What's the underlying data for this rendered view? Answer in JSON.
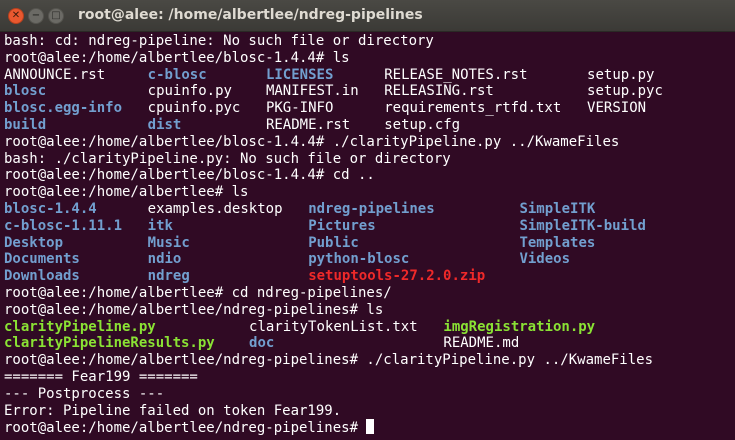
{
  "window": {
    "title": "root@alee: /home/albertlee/ndreg-pipelines",
    "close_glyph": "✕",
    "min_glyph": "−",
    "max_glyph": "□"
  },
  "colors": {
    "background": "#300a24",
    "text": "#ffffff",
    "directory": "#729fcf",
    "executable": "#8ae234",
    "archive": "#ef2929"
  },
  "lines": [
    {
      "text": "bash: cd: ndreg-pipeline: No such file or directory"
    },
    {
      "text": "root@alee:/home/albertlee/blosc-1.4.4# ls"
    },
    {
      "cells": [
        {
          "col": 0,
          "text": "ANNOUNCE.rst",
          "kind": "txt"
        },
        {
          "col": 17,
          "text": "c-blosc",
          "kind": "dir"
        },
        {
          "col": 31,
          "text": "LICENSES",
          "kind": "dir"
        },
        {
          "col": 45,
          "text": "RELEASE_NOTES.rst",
          "kind": "txt"
        },
        {
          "col": 69,
          "text": "setup.py",
          "kind": "txt"
        }
      ]
    },
    {
      "cells": [
        {
          "col": 0,
          "text": "blosc",
          "kind": "dir"
        },
        {
          "col": 17,
          "text": "cpuinfo.py",
          "kind": "txt"
        },
        {
          "col": 31,
          "text": "MANIFEST.in",
          "kind": "txt"
        },
        {
          "col": 45,
          "text": "RELEASING.rst",
          "kind": "txt"
        },
        {
          "col": 69,
          "text": "setup.pyc",
          "kind": "txt"
        }
      ]
    },
    {
      "cells": [
        {
          "col": 0,
          "text": "blosc.egg-info",
          "kind": "dir"
        },
        {
          "col": 17,
          "text": "cpuinfo.pyc",
          "kind": "txt"
        },
        {
          "col": 31,
          "text": "PKG-INFO",
          "kind": "txt"
        },
        {
          "col": 45,
          "text": "requirements_rtfd.txt",
          "kind": "txt"
        },
        {
          "col": 69,
          "text": "VERSION",
          "kind": "txt"
        }
      ]
    },
    {
      "cells": [
        {
          "col": 0,
          "text": "build",
          "kind": "dir"
        },
        {
          "col": 17,
          "text": "dist",
          "kind": "dir"
        },
        {
          "col": 31,
          "text": "README.rst",
          "kind": "txt"
        },
        {
          "col": 45,
          "text": "setup.cfg",
          "kind": "txt"
        }
      ]
    },
    {
      "text": "root@alee:/home/albertlee/blosc-1.4.4# ./clarityPipeline.py ../KwameFiles"
    },
    {
      "text": "bash: ./clarityPipeline.py: No such file or directory"
    },
    {
      "text": "root@alee:/home/albertlee/blosc-1.4.4# cd .."
    },
    {
      "text": "root@alee:/home/albertlee# ls"
    },
    {
      "cells": [
        {
          "col": 0,
          "text": "blosc-1.4.4",
          "kind": "dir"
        },
        {
          "col": 17,
          "text": "examples.desktop",
          "kind": "txt"
        },
        {
          "col": 36,
          "text": "ndreg-pipelines",
          "kind": "dir"
        },
        {
          "col": 61,
          "text": "SimpleITK",
          "kind": "dir"
        }
      ]
    },
    {
      "cells": [
        {
          "col": 0,
          "text": "c-blosc-1.11.1",
          "kind": "dir"
        },
        {
          "col": 17,
          "text": "itk",
          "kind": "dir"
        },
        {
          "col": 36,
          "text": "Pictures",
          "kind": "dir"
        },
        {
          "col": 61,
          "text": "SimpleITK-build",
          "kind": "dir"
        }
      ]
    },
    {
      "cells": [
        {
          "col": 0,
          "text": "Desktop",
          "kind": "dir"
        },
        {
          "col": 17,
          "text": "Music",
          "kind": "dir"
        },
        {
          "col": 36,
          "text": "Public",
          "kind": "dir"
        },
        {
          "col": 61,
          "text": "Templates",
          "kind": "dir"
        }
      ]
    },
    {
      "cells": [
        {
          "col": 0,
          "text": "Documents",
          "kind": "dir"
        },
        {
          "col": 17,
          "text": "ndio",
          "kind": "dir"
        },
        {
          "col": 36,
          "text": "python-blosc",
          "kind": "dir"
        },
        {
          "col": 61,
          "text": "Videos",
          "kind": "dir"
        }
      ]
    },
    {
      "cells": [
        {
          "col": 0,
          "text": "Downloads",
          "kind": "dir"
        },
        {
          "col": 17,
          "text": "ndreg",
          "kind": "dir"
        },
        {
          "col": 36,
          "text": "setuptools-27.2.0.zip",
          "kind": "arc"
        }
      ]
    },
    {
      "text": "root@alee:/home/albertlee# cd ndreg-pipelines/"
    },
    {
      "text": "root@alee:/home/albertlee/ndreg-pipelines# ls"
    },
    {
      "cells": [
        {
          "col": 0,
          "text": "clarityPipeline.py",
          "kind": "exe"
        },
        {
          "col": 29,
          "text": "clarityTokenList.txt",
          "kind": "txt"
        },
        {
          "col": 52,
          "text": "imgRegistration.py",
          "kind": "exe"
        }
      ]
    },
    {
      "cells": [
        {
          "col": 0,
          "text": "clarityPipelineResults.py",
          "kind": "exe"
        },
        {
          "col": 29,
          "text": "doc",
          "kind": "dir"
        },
        {
          "col": 52,
          "text": "README.md",
          "kind": "txt"
        }
      ]
    },
    {
      "text": "root@alee:/home/albertlee/ndreg-pipelines# ./clarityPipeline.py ../KwameFiles"
    },
    {
      "text": "======= Fear199 ======="
    },
    {
      "text": "--- Postprocess ---"
    },
    {
      "text": "Error: Pipeline failed on token Fear199."
    },
    {
      "text": "root@alee:/home/albertlee/ndreg-pipelines# ",
      "cursor": true
    }
  ]
}
